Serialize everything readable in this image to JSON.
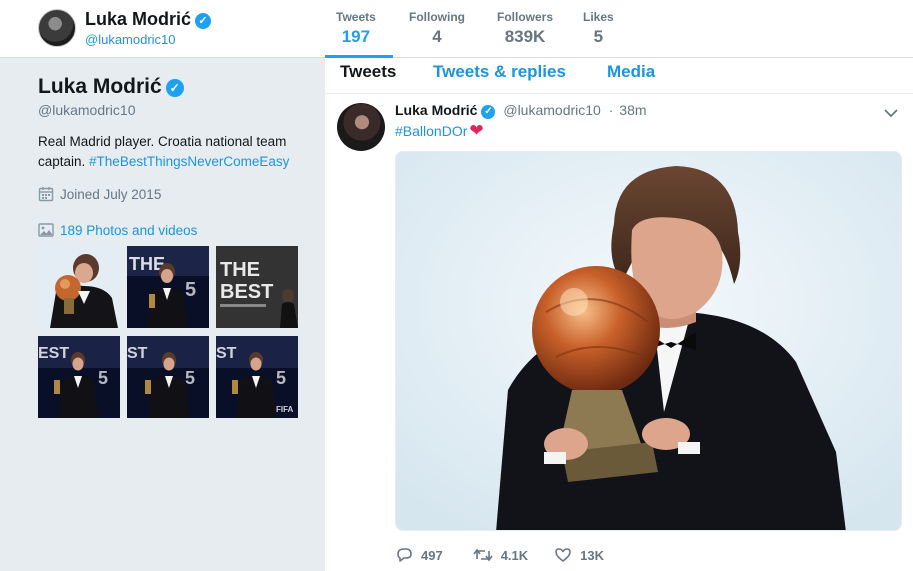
{
  "profile": {
    "name": "Luka Modrić",
    "handle": "@lukamodric10",
    "bio_text": "Real Madrid player. Croatia national team captain. ",
    "bio_hashtag": "#TheBestThingsNeverComeEasy",
    "joined": "Joined July 2015",
    "photos_label": "189 Photos and videos",
    "verified_glyph": "✓"
  },
  "stats": [
    {
      "label": "Tweets",
      "value": "197"
    },
    {
      "label": "Following",
      "value": "4"
    },
    {
      "label": "Followers",
      "value": "839K"
    },
    {
      "label": "Likes",
      "value": "5"
    }
  ],
  "tabs": [
    {
      "label": "Tweets"
    },
    {
      "label": "Tweets & replies"
    },
    {
      "label": "Media"
    }
  ],
  "tweet": {
    "name": "Luka Modrić",
    "handle": "@lukamodric10",
    "separator": "·",
    "time": "38m",
    "text": "#BallonDOr",
    "emoji": "❤",
    "replies": "497",
    "retweets": "4.1K",
    "likes": "13K"
  },
  "thumbnails": [
    {
      "alt": "player-with-trophy"
    },
    {
      "alt": "player-at-the-best-stage"
    },
    {
      "alt": "the-best-logo"
    },
    {
      "alt": "player-at-the-best-stage"
    },
    {
      "alt": "player-at-the-best-stage"
    },
    {
      "alt": "player-at-the-best-stage"
    }
  ],
  "thumb_text": {
    "the_best_line1": "THE",
    "the_best_line2": "BEST",
    "fifa": "FIFA"
  },
  "colors": {
    "accent": "#1da1f2",
    "link": "#1b95e0",
    "muted": "#657786",
    "heart": "#e0245e"
  },
  "icons": {
    "verified": "verified-badge-icon",
    "calendar": "calendar-icon",
    "photo": "photo-icon",
    "caret": "chevron-down-icon",
    "reply": "reply-icon",
    "retweet": "retweet-icon",
    "like": "heart-icon"
  }
}
